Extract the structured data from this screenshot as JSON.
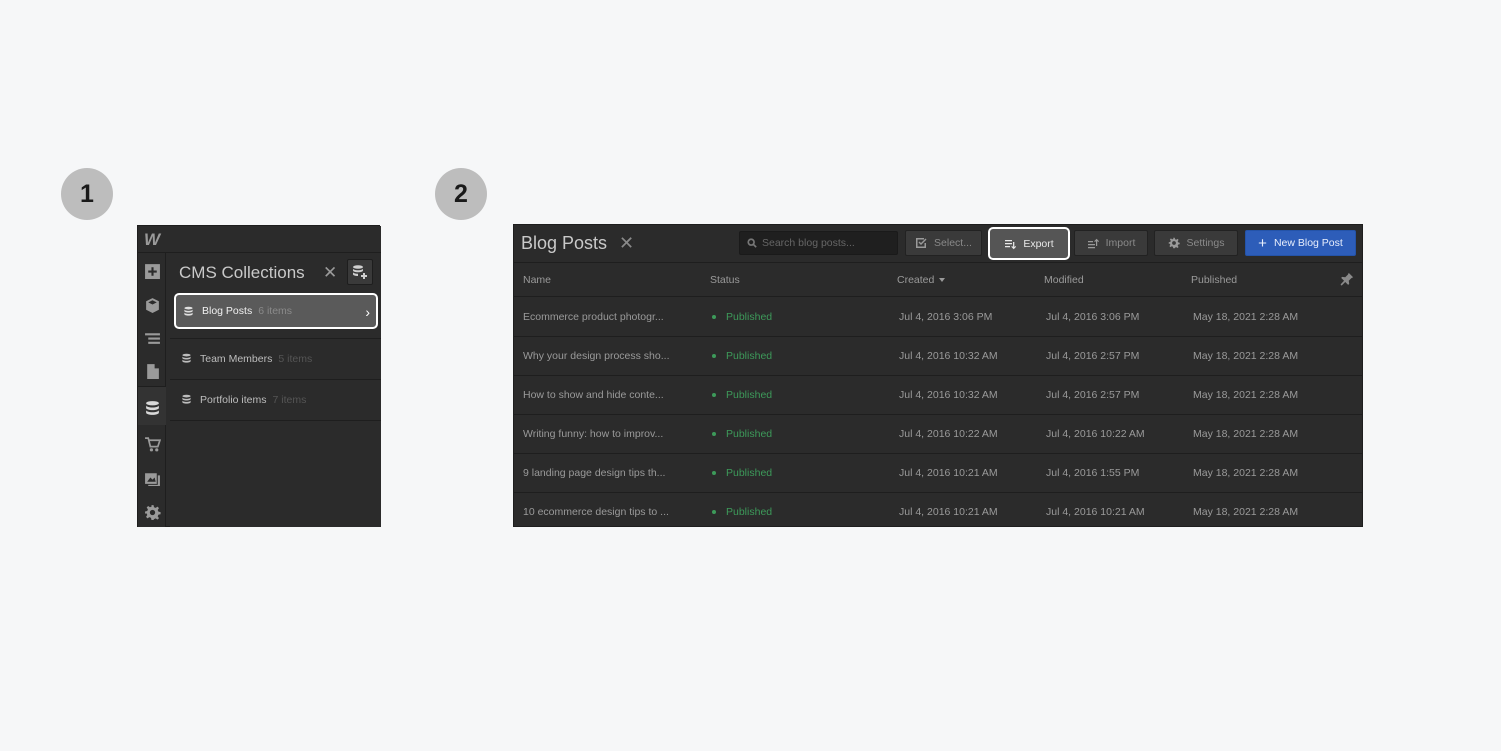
{
  "steps": [
    "1",
    "2"
  ],
  "panel1": {
    "logo": "W",
    "title": "CMS Collections",
    "close": "✕",
    "collections": [
      {
        "name": "Blog Posts",
        "count": "6 items",
        "selected": true
      },
      {
        "name": "Team Members",
        "count": "5 items",
        "selected": false
      },
      {
        "name": "Portfolio items",
        "count": "7 items",
        "selected": false
      }
    ]
  },
  "panel2": {
    "title": "Blog Posts",
    "close": "✕",
    "search_placeholder": "Search blog posts...",
    "buttons": {
      "select": "Select...",
      "export": "Export",
      "import": "Import",
      "settings": "Settings",
      "new": "New Blog Post",
      "new_plus": "+"
    },
    "accent_color": "#2d5db9",
    "status_color": "#3d9a5a",
    "columns": [
      "Name",
      "Status",
      "Created",
      "Modified",
      "Published"
    ],
    "rows": [
      {
        "name": "Ecommerce product photogr...",
        "status": "Published",
        "created": "Jul 4, 2016 3:06 PM",
        "modified": "Jul 4, 2016 3:06 PM",
        "published": "May 18, 2021 2:28 AM"
      },
      {
        "name": "Why your design process sho...",
        "status": "Published",
        "created": "Jul 4, 2016 10:32 AM",
        "modified": "Jul 4, 2016 2:57 PM",
        "published": "May 18, 2021 2:28 AM"
      },
      {
        "name": "How to show and hide conte...",
        "status": "Published",
        "created": "Jul 4, 2016 10:32 AM",
        "modified": "Jul 4, 2016 2:57 PM",
        "published": "May 18, 2021 2:28 AM"
      },
      {
        "name": "Writing funny: how to improv...",
        "status": "Published",
        "created": "Jul 4, 2016 10:22 AM",
        "modified": "Jul 4, 2016 10:22 AM",
        "published": "May 18, 2021 2:28 AM"
      },
      {
        "name": "9 landing page design tips th...",
        "status": "Published",
        "created": "Jul 4, 2016 10:21 AM",
        "modified": "Jul 4, 2016 1:55 PM",
        "published": "May 18, 2021 2:28 AM"
      },
      {
        "name": "10 ecommerce design tips to ...",
        "status": "Published",
        "created": "Jul 4, 2016 10:21 AM",
        "modified": "Jul 4, 2016 10:21 AM",
        "published": "May 18, 2021 2:28 AM"
      }
    ]
  }
}
